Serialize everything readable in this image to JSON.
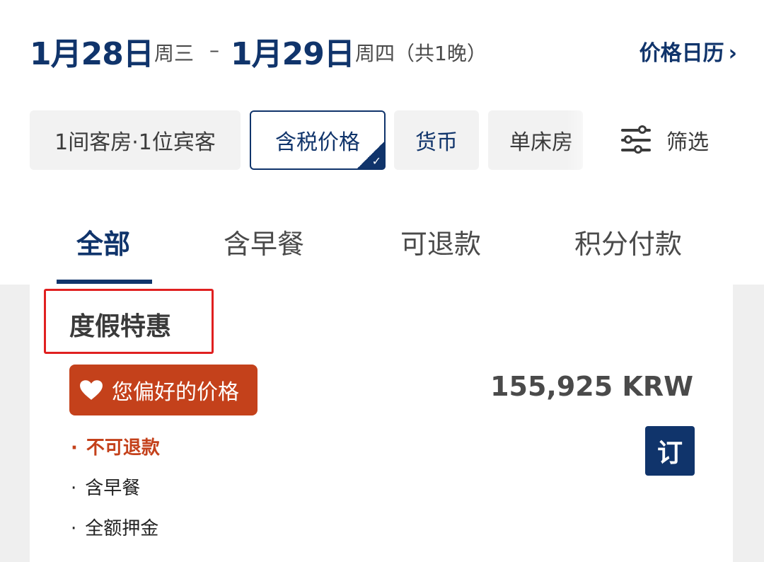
{
  "header": {
    "checkin_date": "1月28日",
    "checkin_day": "周三",
    "separator": "–",
    "checkout_date": "1月29日",
    "checkout_day": "周四（共1晚）",
    "price_calendar_label": "价格日历",
    "chevron": "›"
  },
  "filters": {
    "rooms_guests": "1间客房·1位宾客",
    "tax_price": "含税价格",
    "check_mark": "✓",
    "currency": "货币",
    "single_bed": "单床房",
    "filter_label": "筛选"
  },
  "tabs": {
    "all": "全部",
    "breakfast": "含早餐",
    "refundable": "可退款",
    "points": "积分付款"
  },
  "offer": {
    "title": "度假特惠",
    "badge": "您偏好的价格",
    "price": "155,925 KRW",
    "book_label": "订",
    "bullet": "·",
    "features": [
      "不可退款",
      "含早餐",
      "全额押金"
    ]
  },
  "colors": {
    "brand_navy": "#10346b",
    "accent_orange": "#c4411b",
    "highlight_red": "#e02020"
  },
  "icons": {
    "filter": "sliders-icon",
    "badge": "heart-icon",
    "chevron": "chevron-right-icon",
    "check": "check-icon"
  }
}
